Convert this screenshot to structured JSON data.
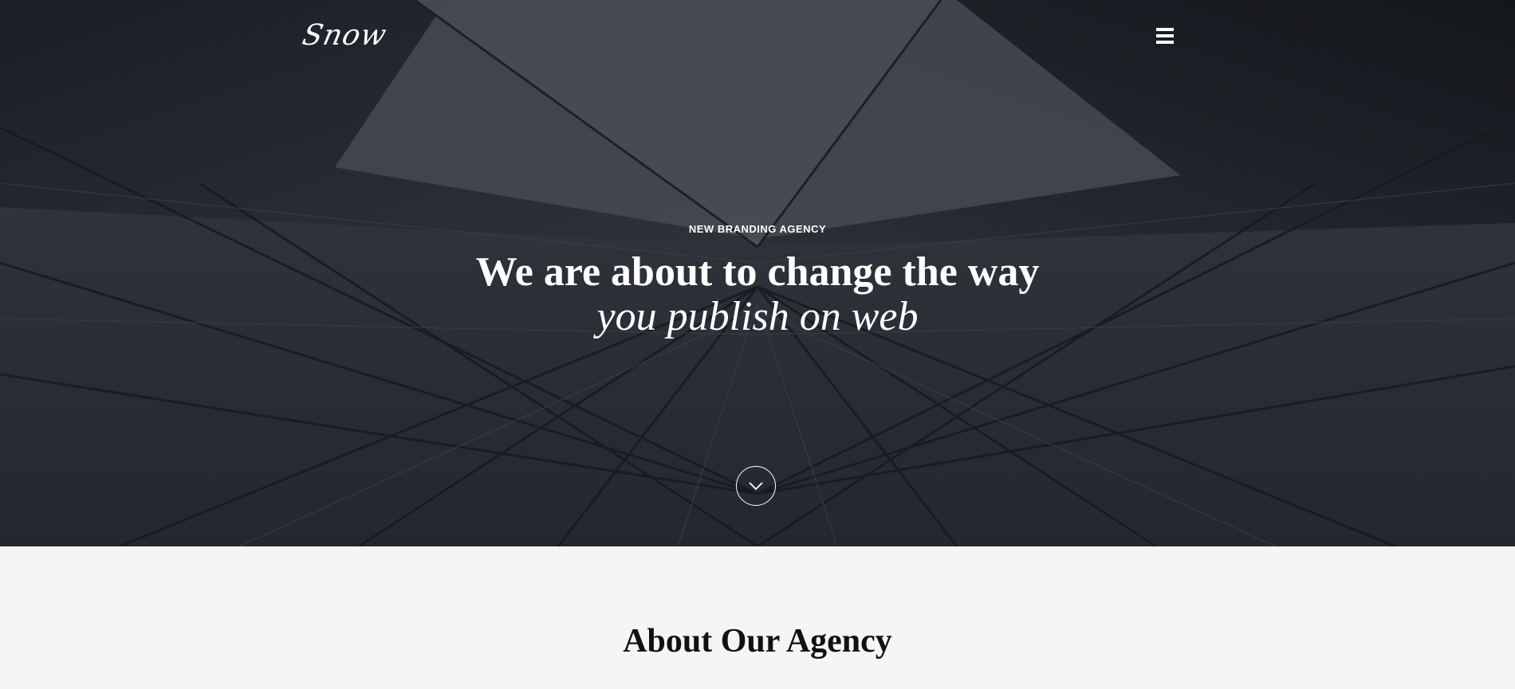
{
  "header": {
    "logo_text": "Snow",
    "menu_icon": "hamburger-menu-icon"
  },
  "hero": {
    "eyebrow": "NEW BRANDING AGENCY",
    "headline_line1": "We are about to change the way",
    "headline_line2": "you publish on web",
    "scroll_icon": "chevron-down-icon"
  },
  "about": {
    "title": "About Our Agency"
  },
  "colors": {
    "hero_overlay": "#2e333a",
    "text_light": "#ffffff",
    "section_bg": "#f5f5f5",
    "heading_dark": "#111111"
  }
}
